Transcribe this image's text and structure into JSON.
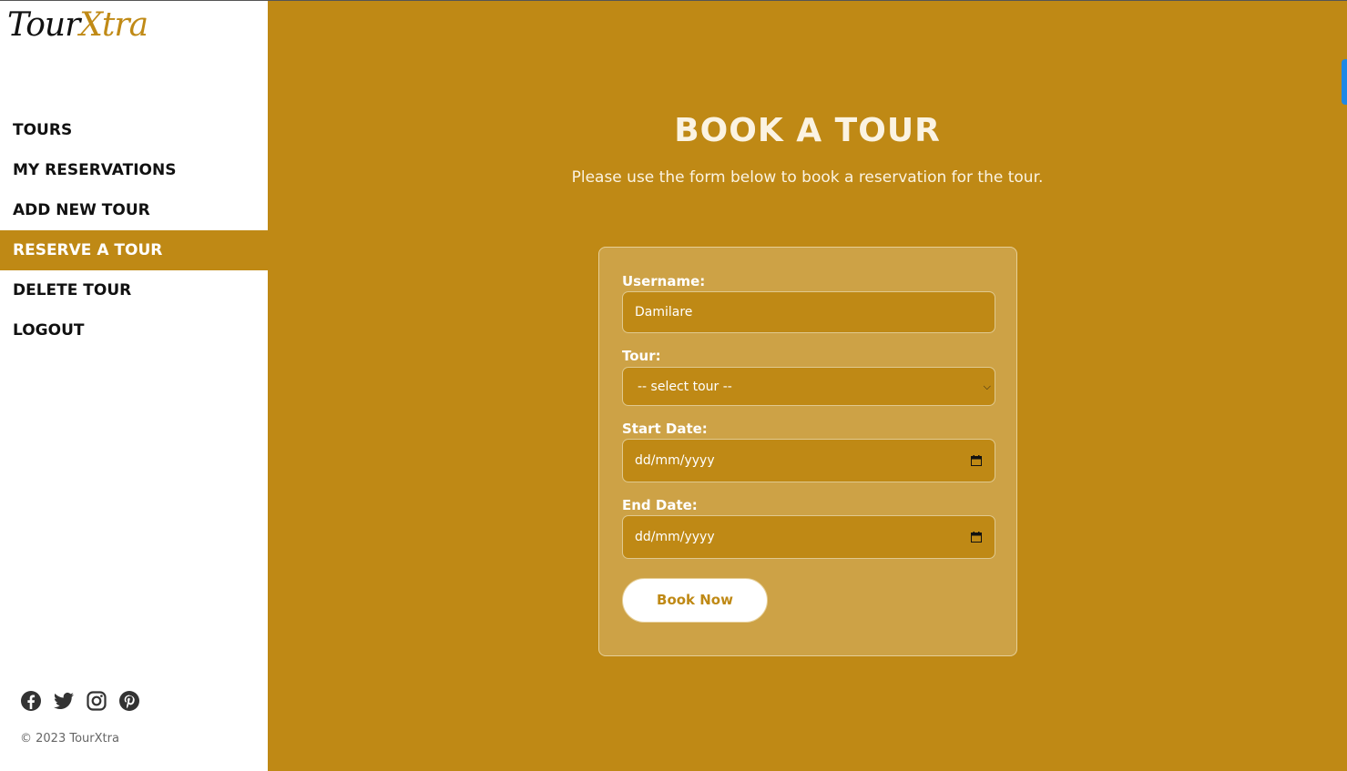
{
  "brand": {
    "part1": "Tour",
    "part2": "Xtra",
    "accent_color": "#bf8915"
  },
  "sidebar": {
    "nav": [
      {
        "label": "TOURS"
      },
      {
        "label": "MY RESERVATIONS"
      },
      {
        "label": "ADD NEW TOUR"
      },
      {
        "label": "RESERVE A TOUR",
        "active": true
      },
      {
        "label": "DELETE TOUR"
      },
      {
        "label": "LOGOUT"
      }
    ],
    "social_icons": [
      "facebook-icon",
      "twitter-icon",
      "instagram-icon",
      "pinterest-icon"
    ],
    "copyright": "© 2023 TourXtra"
  },
  "main": {
    "title": "BOOK A TOUR",
    "subtitle": "Please use the form below to book a reservation for the tour.",
    "form": {
      "username_label": "Username:",
      "username_value": "Damilare",
      "tour_label": "Tour:",
      "tour_selected": "-- select tour --",
      "start_label": "Start Date:",
      "start_placeholder": "dd/mm/yyyy",
      "end_label": "End Date:",
      "end_placeholder": "dd/mm/yyyy",
      "submit_label": "Book Now"
    }
  }
}
